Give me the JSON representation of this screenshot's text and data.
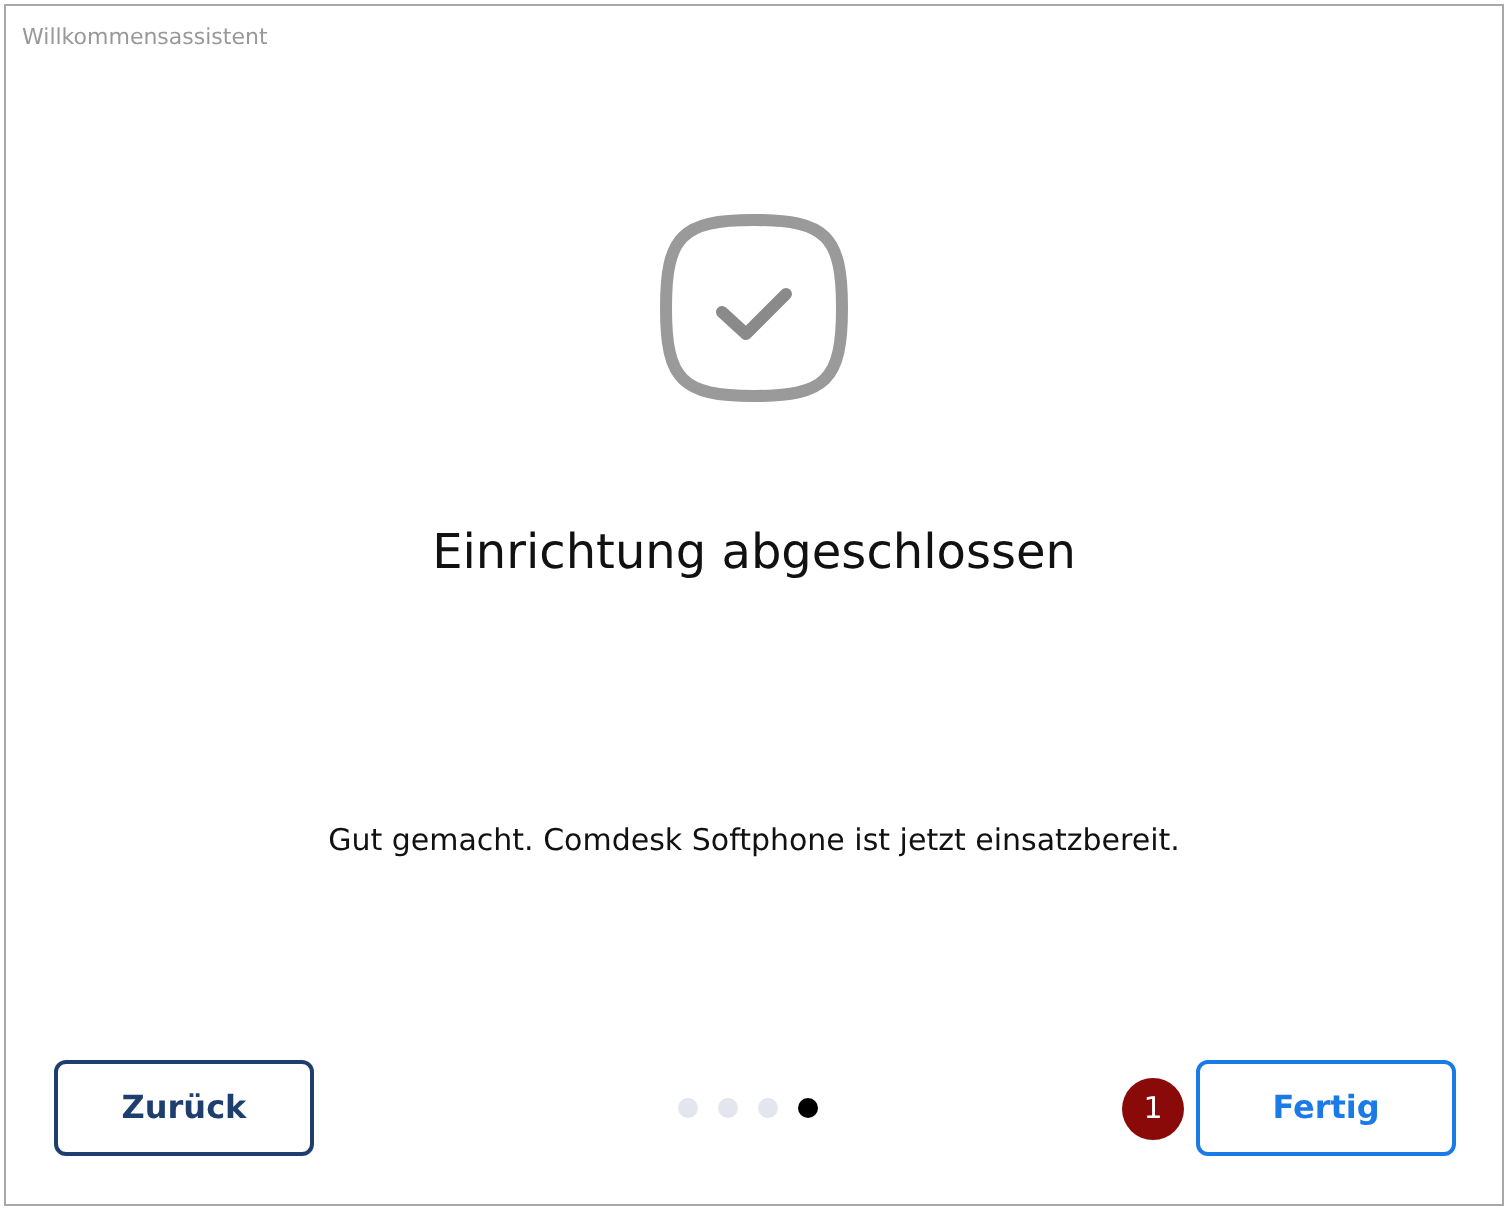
{
  "window": {
    "title": "Willkommensassistent"
  },
  "heading": "Einrichtung abgeschlossen",
  "message": "Gut gemacht. Comdesk Softphone ist jetzt einsatzbereit.",
  "back_button": "Zurück",
  "steps": [
    {
      "selected": false
    },
    {
      "selected": false
    },
    {
      "selected": false
    },
    {
      "selected": true
    }
  ],
  "callout": "1",
  "finish_button": "Fertig"
}
